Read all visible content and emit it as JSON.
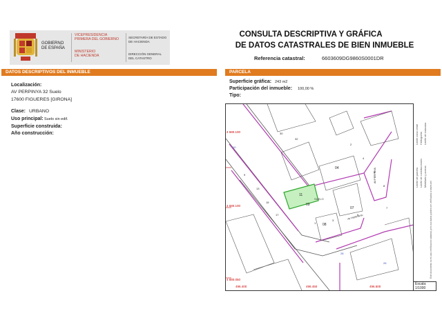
{
  "header": {
    "gobierno": [
      "GOBIERNO",
      "DE ESPAÑA"
    ],
    "vicepresidencia": [
      "VICEPRESIDENCIA",
      "PRIMERA DEL GOBIERNO"
    ],
    "ministerio": [
      "MINISTERIO",
      "DE HACIENDA"
    ],
    "secretaria": [
      "SECRETARÍA DE ESTADO",
      "DE HACIENDA"
    ],
    "direccion": [
      "DIRECCIÓN GENERAL",
      "DEL CATASTRO"
    ],
    "title_line1": "CONSULTA DESCRIPTIVA Y GRÁFICA",
    "title_line2": "DE DATOS CATASTRALES DE BIEN INMUEBLE",
    "ref_label": "Referencia catastral:",
    "ref_value": "6603609DG9860S0001DR"
  },
  "colors": {
    "accent": "#e07b1f",
    "parcel_fill": "#c6f0c0",
    "parcel_outline": "#2ea82e",
    "boundary": "#b23bb2"
  },
  "descriptivos": {
    "section_title": "DATOS DESCRIPTIVOS DEL INMUEBLE",
    "localizacion_label": "Localización:",
    "localizacion_line1": "AV PERPINYA 32 Suelo",
    "localizacion_line2": "17600 FIGUERES [GIRONA]",
    "clase_label": "Clase:",
    "clase_value": "URBANO",
    "uso_label": "Uso principal:",
    "uso_value": "Suelo sin edif.",
    "superficie_label": "Superficie construida:",
    "anio_label": "Año construcción:"
  },
  "parcela": {
    "section_title": "PARCELA",
    "superficie_label": "Superficie gráfica:",
    "superficie_value": "243 m2",
    "participacion_label": "Participación del inmueble:",
    "participacion_value": "100,00 %",
    "tipo_label": "Tipo:"
  },
  "map": {
    "coords_y": [
      "4 680.100",
      "4 680.100",
      "4 680.050"
    ],
    "coords_x": [
      "496.400",
      "496.450",
      "496.500"
    ],
    "parcel_labels": [
      "04",
      "09",
      "07",
      "08",
      "11",
      "SUELO"
    ],
    "street_labels": [
      "AV PERPINYA",
      "AV PERPINYA"
    ],
    "street_numbers": [
      "30",
      "32",
      "10",
      "13",
      "15",
      "17",
      "9",
      "3",
      "5",
      "7",
      "1",
      "28",
      "26",
      "2",
      "4",
      "6",
      "8"
    ],
    "legend_lines": [
      "Límite de parcela",
      "Límite de construcciones",
      "Mobiliario y aceras",
      "Límite zona verde",
      "Hidrografía",
      "Límite de manzana"
    ],
    "legend_note": "Este documento no es una certificación catastral, pero sus datos pueden ser verificados a través del",
    "escala_label": "Escala:",
    "escala_value": "1/1000"
  }
}
